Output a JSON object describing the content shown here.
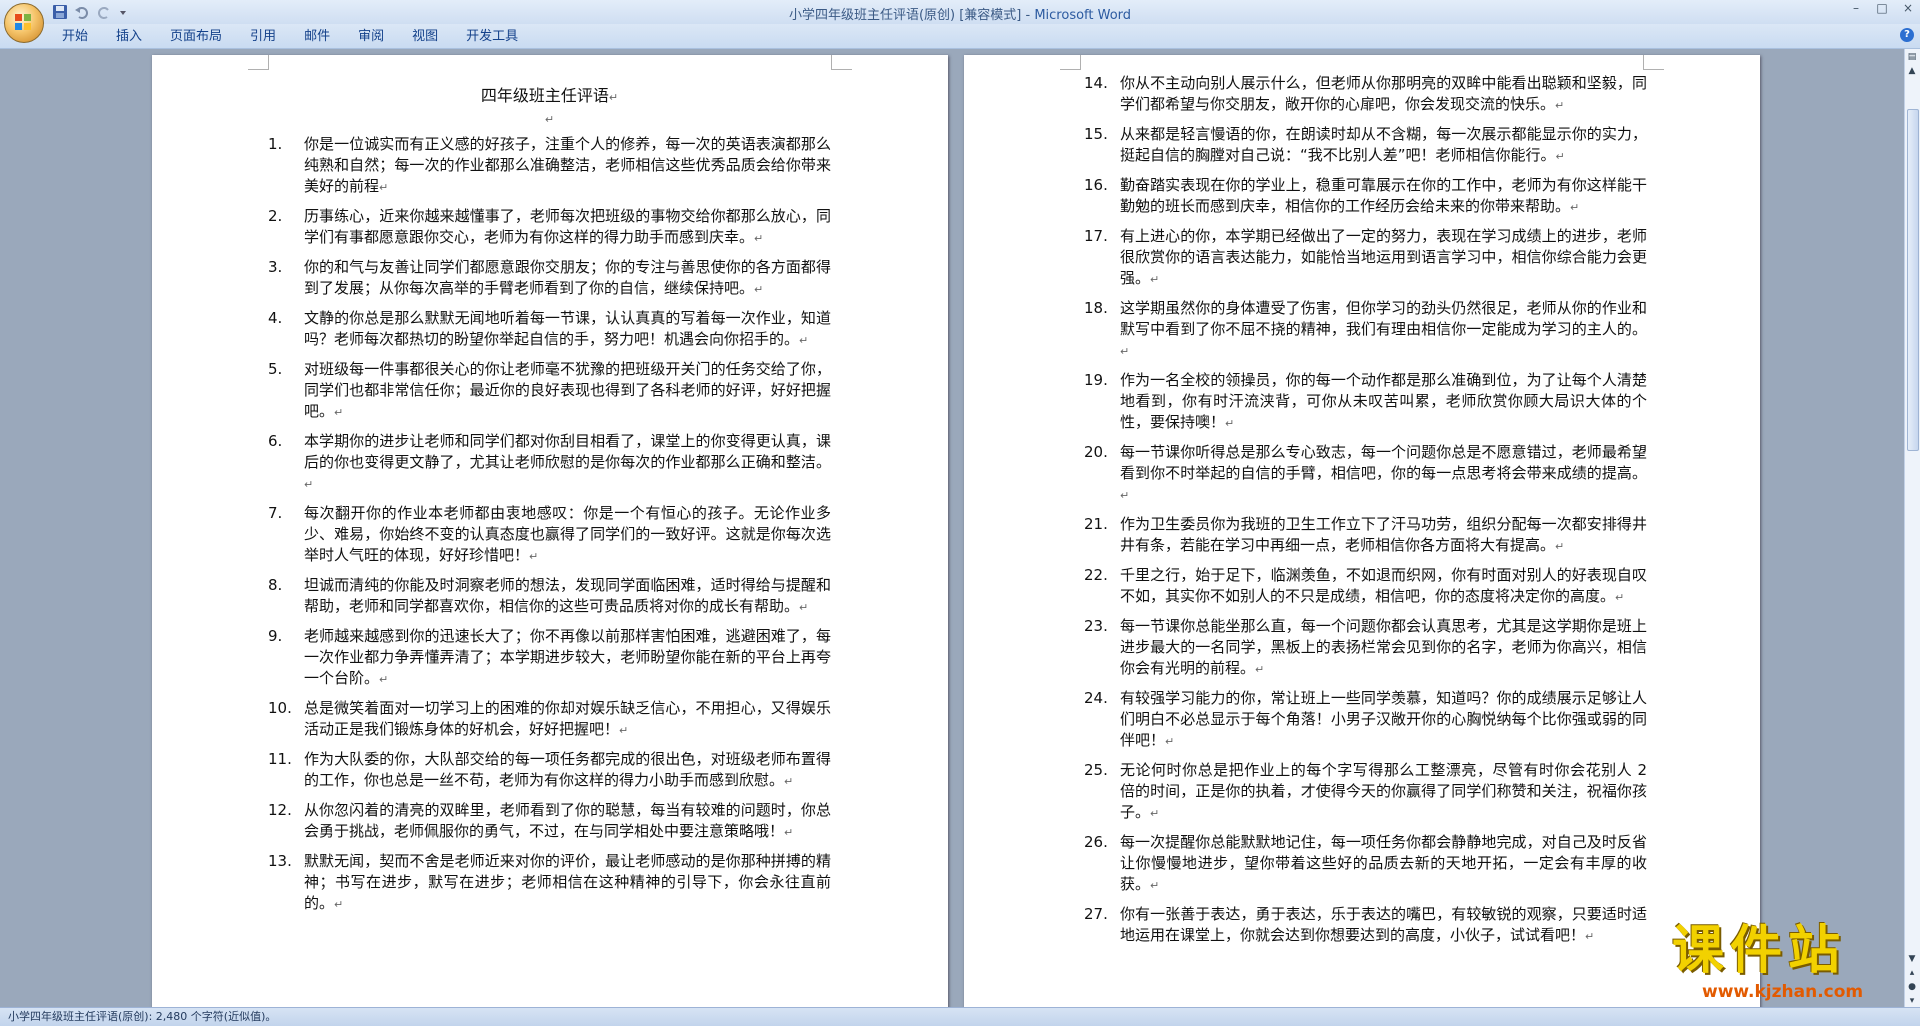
{
  "window": {
    "title": "小学四年级班主任评语(原创) [兼容模式] - ",
    "app_name": "Microsoft Word"
  },
  "ribbon": {
    "tabs": [
      "开始",
      "插入",
      "页面布局",
      "引用",
      "邮件",
      "审阅",
      "视图",
      "开发工具"
    ]
  },
  "document": {
    "title": "四年级班主任评语",
    "page1": [
      {
        "num": "1.",
        "text": "你是一位诚实而有正义感的好孩子，注重个人的修养，每一次的英语表演都那么纯熟和自然；每一次的作业都那么准确整洁，老师相信这些优秀品质会给你带来美好的前程"
      },
      {
        "num": "2.",
        "text": "历事练心，近来你越来越懂事了，老师每次把班级的事物交给你都那么放心，同学们有事都愿意跟你交心，老师为有你这样的得力助手而感到庆幸。"
      },
      {
        "num": "3.",
        "text": "你的和气与友善让同学们都愿意跟你交朋友；你的专注与善思使你的各方面都得到了发展；从你每次高举的手臂老师看到了你的自信，继续保持吧。"
      },
      {
        "num": "4.",
        "text": "文静的你总是那么默默无闻地听着每一节课，认认真真的写着每一次作业，知道吗？老师每次都热切的盼望你举起自信的手，努力吧！机遇会向你招手的。"
      },
      {
        "num": "5.",
        "text": "对班级每一件事都很关心的你让老师毫不犹豫的把班级开关门的任务交给了你，同学们也都非常信任你；最近你的良好表现也得到了各科老师的好评，好好把握吧。"
      },
      {
        "num": "6.",
        "text": "本学期你的进步让老师和同学们都对你刮目相看了，课堂上的你变得更认真，课后的你也变得更文静了，尤其让老师欣慰的是你每次的作业都那么正确和整洁。"
      },
      {
        "num": "7.",
        "text": "每次翻开你的作业本老师都由衷地感叹：你是一个有恒心的孩子。无论作业多少、难易，你始终不变的认真态度也赢得了同学们的一致好评。这就是你每次选举时人气旺的体现，好好珍惜吧！"
      },
      {
        "num": "8.",
        "text": "坦诚而清纯的你能及时洞察老师的想法，发现同学面临困难，适时得给与提醒和帮助，老师和同学都喜欢你，相信你的这些可贵品质将对你的成长有帮助。"
      },
      {
        "num": "9.",
        "text": "老师越来越感到你的迅速长大了；你不再像以前那样害怕困难，逃避困难了，每一次作业都力争弄懂弄清了；本学期进步较大，老师盼望你能在新的平台上再夸一个台阶。"
      },
      {
        "num": "10.",
        "text": "总是微笑着面对一切学习上的困难的你却对娱乐缺乏信心，不用担心，又得娱乐活动正是我们锻炼身体的好机会，好好把握吧！"
      },
      {
        "num": "11.",
        "text": "作为大队委的你，大队部交给的每一项任务都完成的很出色，对班级老师布置得的工作，你也总是一丝不苟，老师为有你这样的得力小助手而感到欣慰。"
      },
      {
        "num": "12.",
        "text": "从你忽闪着的清亮的双眸里，老师看到了你的聪慧，每当有较难的问题时，你总会勇于挑战，老师佩服你的勇气，不过，在与同学相处中要注意策略哦！"
      },
      {
        "num": "13.",
        "text": "默默无闻，契而不舍是老师近来对你的评价，最让老师感动的是你那种拼搏的精神；书写在进步，默写在进步；老师相信在这种精神的引导下，你会永往直前的。"
      }
    ],
    "page2": [
      {
        "num": "14.",
        "text": "你从不主动向别人展示什么，但老师从你那明亮的双眸中能看出聪颖和坚毅，同学们都希望与你交朋友，敞开你的心扉吧，你会发现交流的快乐。"
      },
      {
        "num": "15.",
        "text": "从来都是轻言慢语的你，在朗读时却从不含糊，每一次展示都能显示你的实力，挺起自信的胸膛对自己说：“我不比别人差”吧！老师相信你能行。"
      },
      {
        "num": "16.",
        "text": "勤奋踏实表现在你的学业上，稳重可靠展示在你的工作中，老师为有你这样能干勤勉的班长而感到庆幸，相信你的工作经历会给未来的你带来帮助。"
      },
      {
        "num": "17.",
        "text": "有上进心的你，本学期已经做出了一定的努力，表现在学习成绩上的进步，老师很欣赏你的语言表达能力，如能恰当地运用到语言学习中，相信你综合能力会更强。"
      },
      {
        "num": "18.",
        "text": "这学期虽然你的身体遭受了伤害，但你学习的劲头仍然很足，老师从你的作业和默写中看到了你不屈不挠的精神，我们有理由相信你一定能成为学习的主人的。"
      },
      {
        "num": "19.",
        "text": "作为一名全校的领操员，你的每一个动作都是那么准确到位，为了让每个人清楚地看到，你有时汗流浃背，可你从未叹苦叫累，老师欣赏你顾大局识大体的个性，要保持噢！"
      },
      {
        "num": "20.",
        "text": "每一节课你听得总是那么专心致志，每一个问题你总是不愿意错过，老师最希望看到你不时举起的自信的手臂，相信吧，你的每一点思考将会带来成绩的提高。"
      },
      {
        "num": "21.",
        "text": "作为卫生委员你为我班的卫生工作立下了汗马功劳，组织分配每一次都安排得井井有条，若能在学习中再细一点，老师相信你各方面将大有提高。"
      },
      {
        "num": "22.",
        "text": "千里之行，始于足下，临渊羡鱼，不如退而织网，你有时面对别人的好表现自叹不如，其实你不如别人的不只是成绩，相信吧，你的态度将决定你的高度。"
      },
      {
        "num": "23.",
        "text": "每一节课你总能坐那么直，每一个问题你都会认真思考，尤其是这学期你是班上进步最大的一名同学，黑板上的表扬栏常会见到你的名字，老师为你高兴，相信你会有光明的前程。"
      },
      {
        "num": "24.",
        "text": "有较强学习能力的你，常让班上一些同学羡慕，知道吗？你的成绩展示足够让人们明白不必总显示于每个角落！小男子汉敞开你的心胸悦纳每个比你强或弱的同伴吧！"
      },
      {
        "num": "25.",
        "text": "无论何时你总是把作业上的每个字写得那么工整漂亮，尽管有时你会花别人 2 倍的时间，正是你的执着，才使得今天的你赢得了同学们称赞和关注，祝福你孩子。"
      },
      {
        "num": "26.",
        "text": "每一次提醒你总能默默地记住，每一项任务你都会静静地完成，对自己及时反省让你慢慢地进步，望你带着这些好的品质去新的天地开拓，一定会有丰厚的收获。"
      },
      {
        "num": "27.",
        "text": "你有一张善于表达，勇于表达，乐于表达的嘴巴，有较敏锐的观察，只要适时适地运用在课堂上，你就会达到你想要达到的高度，小伙子，试试看吧！"
      }
    ]
  },
  "statusbar": {
    "text": "小学四年级班主任评语(原创): 2,480 个字符(近似值)。"
  },
  "watermark": {
    "main": "课件站",
    "url": "www.kjzhan.com"
  },
  "colors": {
    "title_app": "#2c5aa0",
    "ribbon_text": "#15428b",
    "watermark_yellow": "#f2d100",
    "watermark_orange": "#e25a00"
  }
}
